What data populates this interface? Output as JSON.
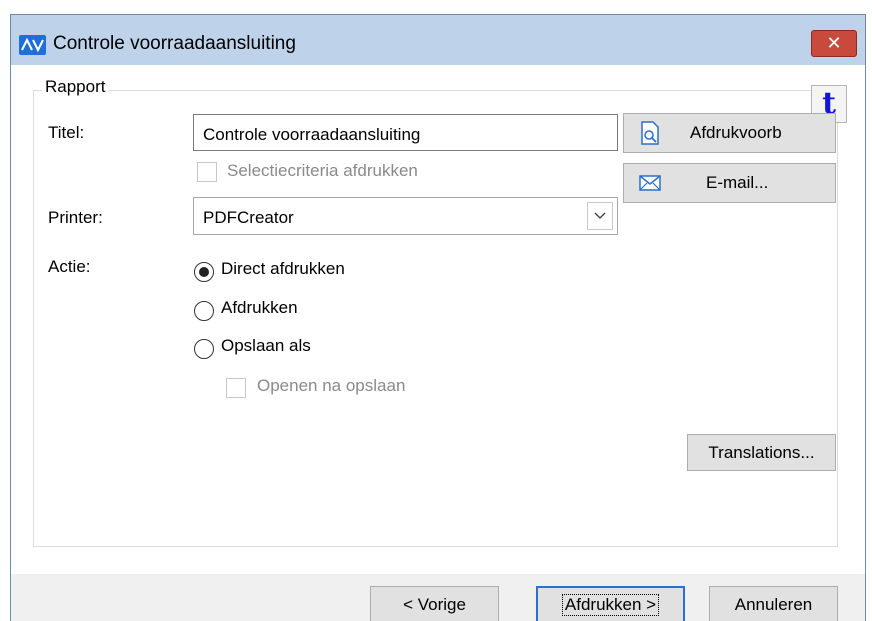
{
  "window": {
    "title": "Controle voorraadaansluiting",
    "close_glyph": "✕"
  },
  "group": {
    "caption": "Rapport",
    "badge": "t"
  },
  "form": {
    "titel_label": "Titel:",
    "titel_value": "Controle voorraadaansluiting",
    "selectie_label": "Selectiecriteria afdrukken",
    "printer_label": "Printer:",
    "printer_value": "PDFCreator",
    "actie_label": "Actie:",
    "radio_direct": "Direct afdrukken",
    "radio_afdrukken": "Afdrukken",
    "radio_opslaan": "Opslaan als",
    "openen_label": "Openen na opslaan"
  },
  "side_buttons": {
    "preview": "Afdrukvoorb",
    "email": "E-mail..."
  },
  "translations_button": "Translations...",
  "footer": {
    "back": "< Vorige",
    "print": "Afdrukken >",
    "cancel": "Annuleren"
  },
  "colors": {
    "titlebar": "#bed3ea",
    "close": "#c84a3c",
    "logo": "#1e6fd9",
    "badge_text": "#1515d6",
    "default_button_border": "#2b6fd1"
  },
  "state": {
    "action_selected": "Direct afdrukken",
    "selectie_checked": false,
    "openen_checked": false
  }
}
